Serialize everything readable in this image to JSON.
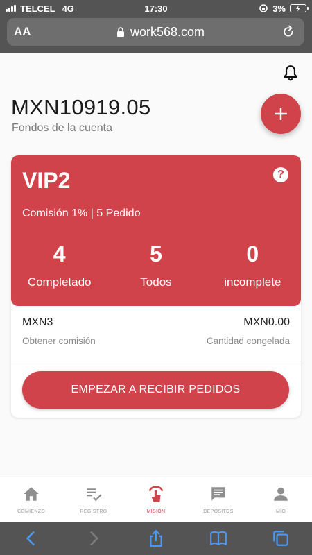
{
  "status_bar": {
    "carrier": "TELCEL",
    "network": "4G",
    "time": "17:30",
    "battery": "3%"
  },
  "browser": {
    "aa_label": "AA",
    "url": "work568.com"
  },
  "account": {
    "balance": "MXN10919.05",
    "balance_label": "Fondos de la cuenta"
  },
  "vip": {
    "title": "VIP2",
    "help_label": "?",
    "subtitle": "Comisión 1% | 5 Pedido",
    "stats": [
      {
        "value": "4",
        "label": "Completado"
      },
      {
        "value": "5",
        "label": "Todos"
      },
      {
        "value": "0",
        "label": "incomplete"
      }
    ]
  },
  "commission": {
    "value": "MXN3",
    "label": "Obtener comisión"
  },
  "frozen": {
    "value": "MXN0.00",
    "label": "Cantidad congelada"
  },
  "start_button": "EMPEZAR A RECIBIR PEDIDOS",
  "tabs": [
    {
      "label": "COMIENZO",
      "icon": "home-icon"
    },
    {
      "label": "REGISTRO",
      "icon": "record-list-icon"
    },
    {
      "label": "MISIÓN",
      "icon": "mission-hand-icon",
      "active": true
    },
    {
      "label": "DEPÓSITOS",
      "icon": "chat-icon"
    },
    {
      "label": "MÍO",
      "icon": "person-icon"
    }
  ],
  "colors": {
    "accent": "#d1434a",
    "chrome": "#545454",
    "safari_blue": "#4a9af5"
  }
}
